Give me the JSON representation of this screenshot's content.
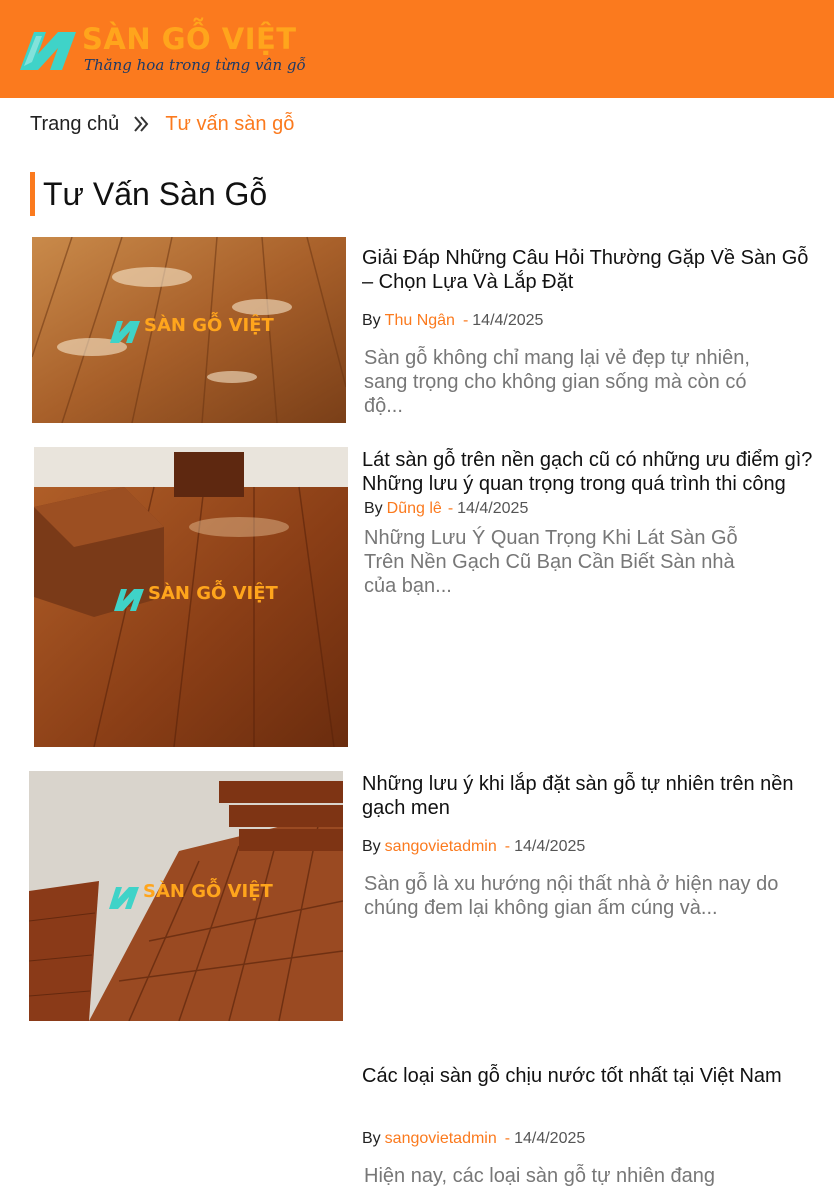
{
  "header": {
    "logo_title": "SÀN GỖ VIỆT",
    "logo_slogan": "Thăng hoa trong từng vân gỗ"
  },
  "breadcrumb": {
    "home": "Trang chủ",
    "separator_icon": "double-chevron-right-icon",
    "current": "Tư vấn sàn gỗ"
  },
  "page": {
    "title": "Tư Vấn Sàn Gỗ"
  },
  "posts": [
    {
      "title": "Giải Đáp Những Câu Hỏi Thường Gặp Về Sàn Gỗ – Chọn Lựa Và Lắp Đặt",
      "by": "By",
      "author": "Thu Ngân",
      "dash": "-",
      "date": "14/4/2025",
      "excerpt": "Sàn gỗ không chỉ mang lại vẻ đẹp tự nhiên, sang trọng cho không gian sống mà còn có độ...",
      "watermark": "SÀN GỖ VIỆT"
    },
    {
      "title": "Lát sàn gỗ trên nền gạch cũ có những ưu điểm gì? Những lưu ý quan trọng trong quá trình thi công",
      "by": "By",
      "author": "Dũng lê",
      "dash": "-",
      "date": "14/4/2025",
      "excerpt": "Những Lưu Ý Quan Trọng Khi Lát Sàn Gỗ Trên Nền Gạch Cũ Bạn Cần Biết Sàn nhà của bạn...",
      "watermark": "SÀN GỖ VIỆT"
    },
    {
      "title": "Những lưu ý khi lắp đặt sàn gỗ tự nhiên trên nền gạch men",
      "by": "By",
      "author": "sangovietadmin",
      "dash": "-",
      "date": "14/4/2025",
      "excerpt": "Sàn gỗ là xu hướng nội thất nhà ở hiện nay do chúng đem lại không gian ấm cúng và...",
      "watermark": "SÀN GỖ VIỆT"
    },
    {
      "title": "Các loại sàn gỗ chịu nước tốt nhất tại Việt Nam",
      "by": "By",
      "author": "sangovietadmin",
      "dash": "-",
      "date": "14/4/2025",
      "excerpt": "Hiện nay, các loại sàn gỗ tự nhiên đang"
    }
  ],
  "colors": {
    "brand_orange": "#fb7a1e",
    "logo_yellow": "#ffa51c",
    "logo_teal": "#3fd3c8",
    "text_dark": "#111111",
    "text_muted": "#777777"
  }
}
